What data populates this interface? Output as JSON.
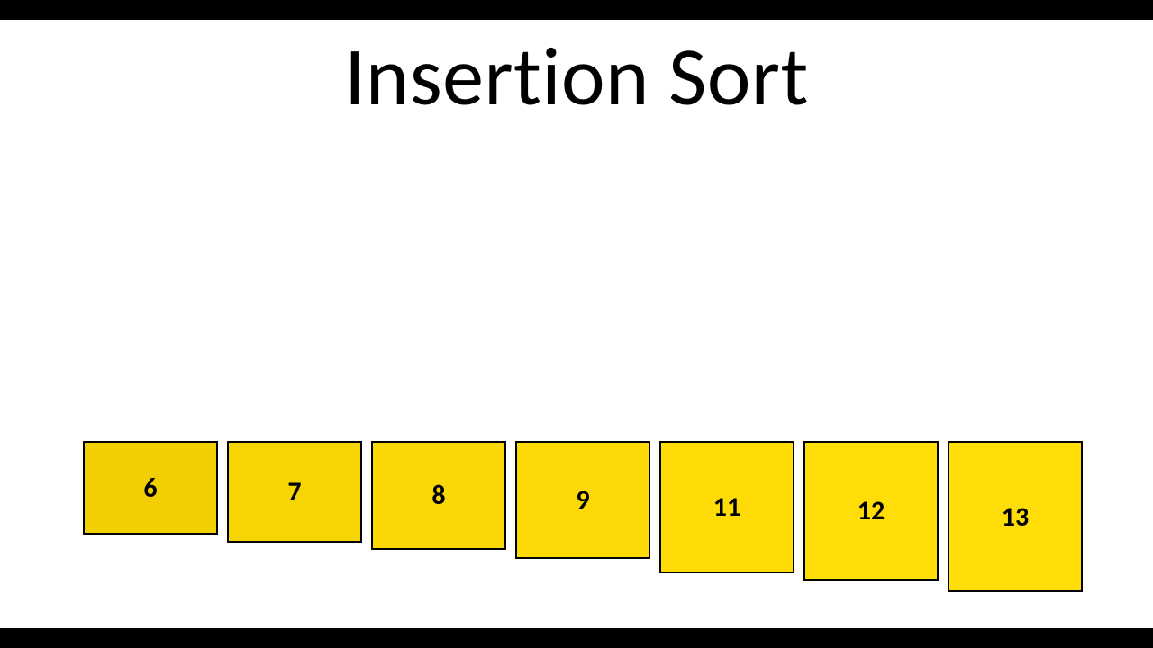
{
  "title": "Insertion Sort",
  "boxes": {
    "b0": "6",
    "b1": "7",
    "b2": "8",
    "b3": "9",
    "b4": "11",
    "b5": "12",
    "b6": "13"
  }
}
